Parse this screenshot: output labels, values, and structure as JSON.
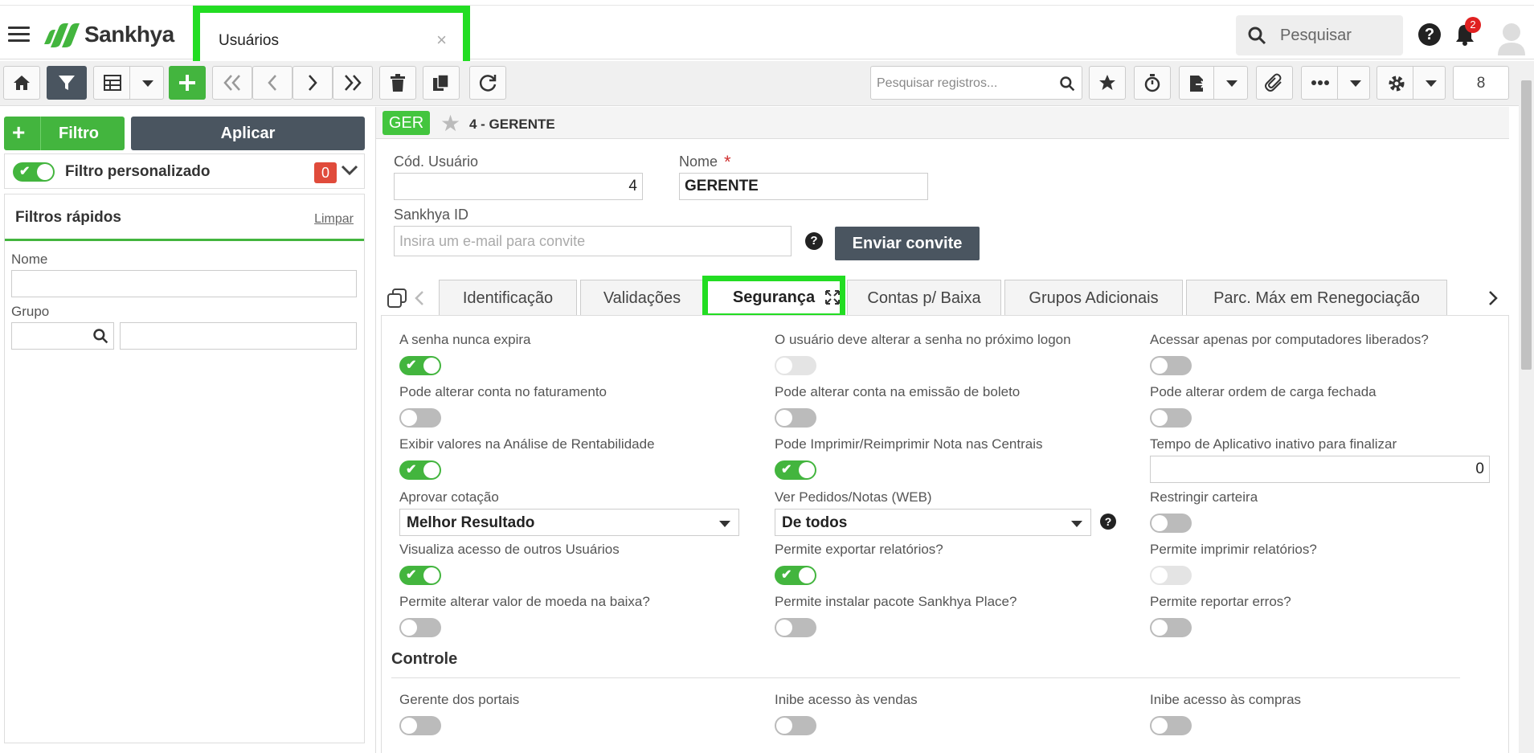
{
  "app": {
    "logo_text": "Sankhya",
    "brand_green": "#43b53e",
    "highlight": "#22dd22"
  },
  "top_tab": {
    "label": "Usuários",
    "close": "×"
  },
  "top_search": {
    "placeholder": "Pesquisar"
  },
  "notifications": {
    "count": "2"
  },
  "toolbar": {
    "search_placeholder": "Pesquisar registros...",
    "record_count": "8"
  },
  "left": {
    "filtro_label": "Filtro",
    "aplicar_label": "Aplicar",
    "filtro_personalizado": "Filtro personalizado",
    "filtro_count": "0",
    "filtros_rapidos": "Filtros rápidos",
    "limpar": "Limpar",
    "nome_label": "Nome",
    "grupo_label": "Grupo"
  },
  "record": {
    "badge": "GER",
    "title": "4 - GERENTE"
  },
  "form": {
    "cod_label": "Cód. Usuário",
    "cod_value": "4",
    "nome_label": "Nome",
    "required_mark": "*",
    "nome_value": "GERENTE",
    "sankhya_id_label": "Sankhya ID",
    "sankhya_id_placeholder": "Insira um e-mail para convite",
    "enviar_convite": "Enviar convite"
  },
  "tabs": [
    "Identificação",
    "Validações",
    "Segurança",
    "Contas p/ Baixa",
    "Grupos Adicionais",
    "Parc. Máx em Renegociação"
  ],
  "security": {
    "opt1": "A senha nunca expira",
    "opt2": "O usuário deve alterar a senha no próximo logon",
    "opt3": "Acessar apenas por computadores liberados?",
    "opt4": "Pode alterar conta no faturamento",
    "opt5": "Pode alterar conta na emissão de boleto",
    "opt6": "Pode alterar ordem de carga fechada",
    "opt7": "Exibir valores na Análise de Rentabilidade",
    "opt8": "Pode Imprimir/Reimprimir Nota nas Centrais",
    "opt9": "Tempo de Aplicativo inativo para finalizar",
    "opt9_value": "0",
    "opt10": "Aprovar cotação",
    "opt10_value": "Melhor Resultado",
    "opt11": "Ver Pedidos/Notas (WEB)",
    "opt11_value": "De todos",
    "opt12": "Restringir carteira",
    "opt13": "Visualiza acesso de outros Usuários",
    "opt14": "Permite exportar relatórios?",
    "opt15": "Permite imprimir relatórios?",
    "opt16": "Permite alterar valor de moeda na baixa?",
    "opt17": "Permite instalar pacote Sankhya Place?",
    "opt18": "Permite reportar erros?"
  },
  "controle": {
    "title": "Controle",
    "opt1": "Gerente dos portais",
    "opt2": "Inibe acesso às vendas",
    "opt3": "Inibe acesso às compras"
  }
}
